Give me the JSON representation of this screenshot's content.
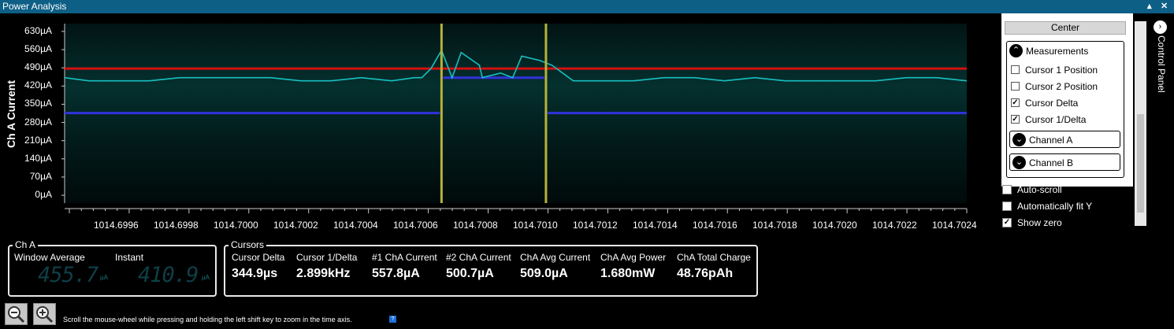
{
  "window": {
    "title": "Power Analysis",
    "pin_icon": "▴",
    "close_icon": "✕"
  },
  "chart_data": {
    "type": "line",
    "ylabel": "Ch A Current",
    "y_ticks": [
      "630µA",
      "560µA",
      "490µA",
      "420µA",
      "350µA",
      "280µA",
      "210µA",
      "140µA",
      "70µA",
      "0µA"
    ],
    "x_ticks": [
      "1014.6996",
      "1014.6998",
      "1014.7000",
      "1014.7002",
      "1014.7004",
      "1014.7006",
      "1014.7008",
      "1014.7010",
      "1014.7012",
      "1014.7014",
      "1014.7016",
      "1014.7018",
      "1014.7020",
      "1014.7022",
      "1014.7024"
    ],
    "xlim": [
      1014.69947,
      1014.70245
    ],
    "ylim": [
      -30,
      660
    ],
    "series": [
      {
        "color": "#18c0c0",
        "x": [
          1014.69947,
          1014.69955,
          1014.69965,
          1014.69975,
          1014.69985,
          1014.69995,
          1014.70005,
          1014.70015,
          1014.70025,
          1014.70035,
          1014.70045,
          1014.70055,
          1014.70065,
          1014.70075,
          1014.70085,
          1014.70095,
          1014.700625,
          1014.70068,
          1014.700715,
          1014.70078,
          1014.70084,
          1014.70091,
          1014.70098,
          1014.70104,
          1014.70108,
          1014.70115,
          1014.70125,
          1014.70135,
          1014.70145,
          1014.70155,
          1014.70165,
          1014.70175,
          1014.70185,
          1014.70195,
          1014.70205,
          1014.70215,
          1014.70225,
          1014.70235,
          1014.70245
        ],
        "y": [
          452,
          440,
          440,
          440,
          452,
          452,
          452,
          452,
          440,
          440,
          452,
          440,
          452,
          452,
          452,
          452,
          452,
          487,
          557,
          549,
          500,
          470,
          535,
          518,
          500,
          440,
          440,
          440,
          452,
          452,
          440,
          452,
          440,
          440,
          440,
          440,
          452,
          452,
          440
        ]
      }
    ],
    "cursors": [
      {
        "name": "Cursor 1",
        "x": 1014.700715
      },
      {
        "name": "Cursor 2",
        "x": 1014.70106
      }
    ],
    "hline_red": 487,
    "hline_blue_outside": 316,
    "hline_blue_inside": 452,
    "colors": {
      "plot_bg": "#02191a",
      "cursor": "#b7b13b",
      "red": "#d31010",
      "blue": "#3232dc"
    }
  },
  "cha": {
    "legend": "Ch A",
    "window_avg_label": "Window Average",
    "instant_label": "Instant",
    "window_avg_value": "455.7",
    "instant_value": "410.9",
    "unit": "µA"
  },
  "cursors_panel": {
    "legend": "Cursors",
    "columns": [
      {
        "label": "Cursor Delta",
        "value": "344.9µs"
      },
      {
        "label": "Cursor 1/Delta",
        "value": "2.899kHz"
      },
      {
        "label": "#1 ChA Current",
        "value": "557.8µA"
      },
      {
        "label": "#2 ChA Current",
        "value": "500.7µA"
      },
      {
        "label": "ChA Avg Current",
        "value": "509.0µA"
      },
      {
        "label": "ChA Avg Power",
        "value": "1.680mW"
      },
      {
        "label": "ChA Total Charge",
        "value": "48.76pAh"
      }
    ]
  },
  "hint": "Scroll the mouse-wheel while pressing and holding the left shift key to zoom in the time axis.",
  "hint_icon": "?",
  "zoom_out_icon": "zoom-out",
  "zoom_in_icon": "zoom-in",
  "control_panel": {
    "title": "Control Panel",
    "center_button": "Center",
    "measurements_title": "Measurements",
    "measurements": [
      {
        "label": "Cursor 1 Position",
        "checked": false
      },
      {
        "label": "Cursor 2 Position",
        "checked": false
      },
      {
        "label": "Cursor Delta",
        "checked": true
      },
      {
        "label": "Cursor 1/Delta",
        "checked": true
      }
    ],
    "channel_a": "Channel A",
    "channel_b": "Channel B",
    "options": [
      {
        "label": "Auto-scroll",
        "checked": false
      },
      {
        "label": "Automatically fit Y",
        "checked": false
      },
      {
        "label": "Show zero",
        "checked": true
      }
    ],
    "check_mark": "✓",
    "expand_icon": "⌄",
    "collapse_icon": "⌃"
  }
}
